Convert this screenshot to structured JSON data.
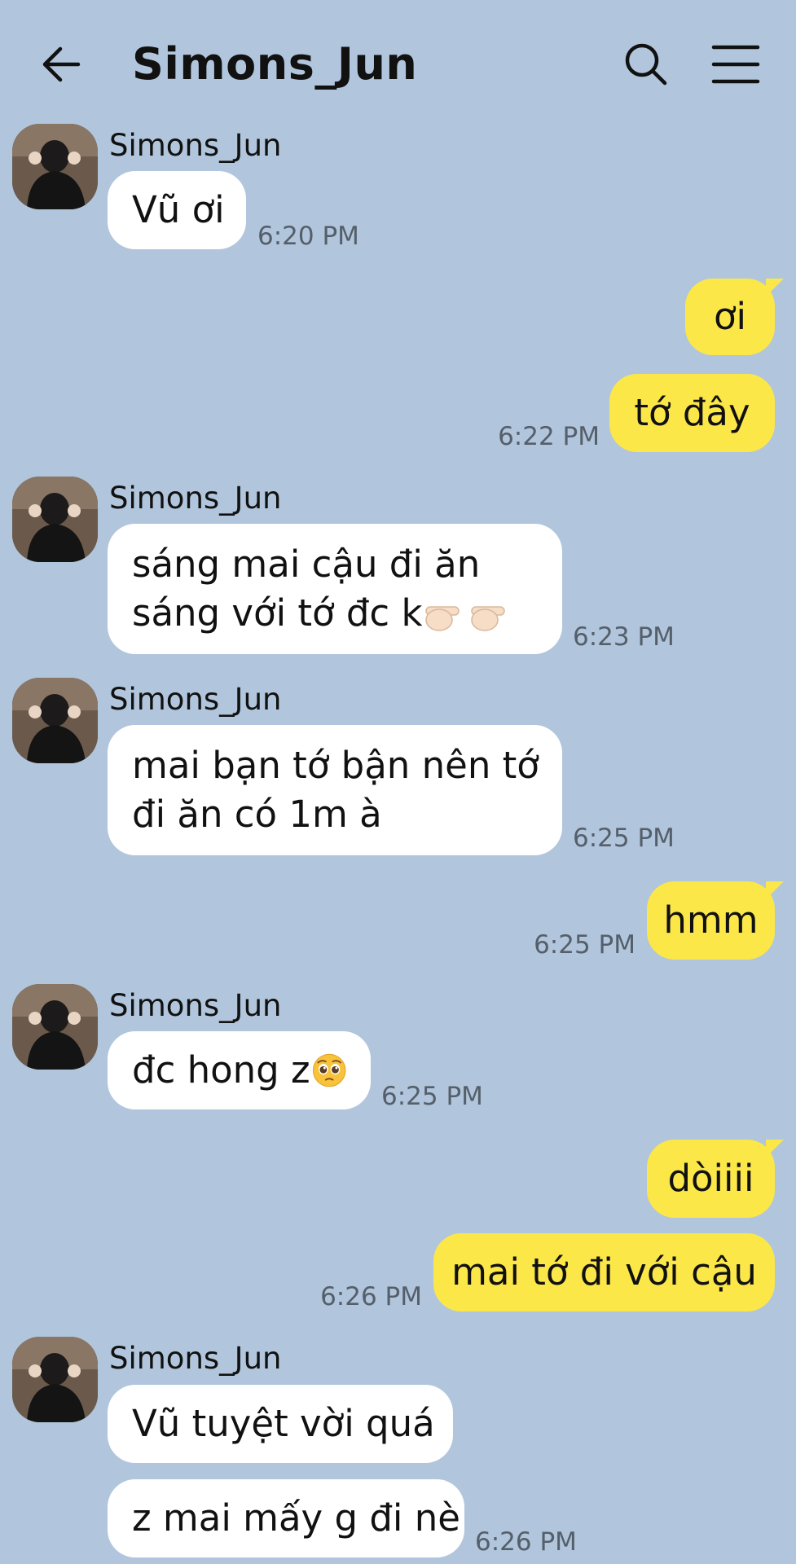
{
  "header": {
    "title": "Simons_Jun",
    "back_icon": "arrow-left-icon",
    "search_icon": "search-icon",
    "menu_icon": "hamburger-menu-icon"
  },
  "colors": {
    "background": "#b1c6dc",
    "incoming_bubble": "#ffffff",
    "outgoing_bubble": "#fce749",
    "timestamp": "#555f6b"
  },
  "messages": [
    {
      "sender": "Simons_Jun",
      "direction": "in",
      "text": "Vũ ơi",
      "time": "6:20 PM"
    },
    {
      "direction": "out",
      "text": "ơi"
    },
    {
      "direction": "out",
      "text": "tớ đây",
      "time": "6:22 PM"
    },
    {
      "sender": "Simons_Jun",
      "direction": "in",
      "line1": "sáng mai cậu đi ăn",
      "line2": "sáng với tớ đc k",
      "emoji": "pointing-hands-emoji",
      "time": "6:23 PM"
    },
    {
      "sender": "Simons_Jun",
      "direction": "in",
      "line1": "mai bạn tớ bận nên tớ",
      "line2": "đi ăn có 1m à",
      "time": "6:25 PM"
    },
    {
      "direction": "out",
      "text": "hmm",
      "time": "6:25 PM"
    },
    {
      "sender": "Simons_Jun",
      "direction": "in",
      "text": "đc hong z",
      "emoji": "pleading-face-emoji",
      "time": "6:25 PM"
    },
    {
      "direction": "out",
      "text": "dòiiii"
    },
    {
      "direction": "out",
      "text": "mai tớ đi với cậu",
      "time": "6:26 PM"
    },
    {
      "sender": "Simons_Jun",
      "direction": "in",
      "text": "Vũ tuyệt vời quá"
    },
    {
      "direction": "in",
      "text": "z mai mấy g đi nè",
      "time": "6:26 PM"
    }
  ]
}
